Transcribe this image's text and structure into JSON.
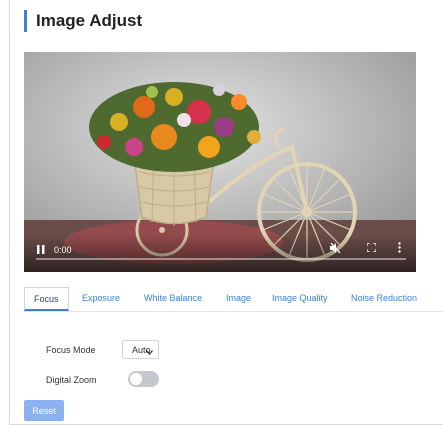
{
  "header": {
    "title": "Image Adjust"
  },
  "video": {
    "time": "0:00",
    "controls": {
      "play_icon": "pause-icon",
      "mute_icon": "muted-speaker-icon",
      "fullscreen_icon": "fullscreen-icon",
      "menu_icon": "kebab-menu-icon"
    }
  },
  "tabs": [
    {
      "label": "Focus",
      "active": true
    },
    {
      "label": "Exposure"
    },
    {
      "label": "White Balance"
    },
    {
      "label": "Image"
    },
    {
      "label": "Image Quality"
    },
    {
      "label": "Noise Reduction"
    }
  ],
  "form": {
    "focus_mode_label": "Focus Mode",
    "focus_mode_value": "Auto",
    "digital_zoom_label": "Digital Zoom",
    "digital_zoom_on": false
  },
  "actions": {
    "reset_label": "Reset"
  },
  "colors": {
    "accent": "#3d7fd6",
    "reset_bg": "#8bb1ee"
  }
}
